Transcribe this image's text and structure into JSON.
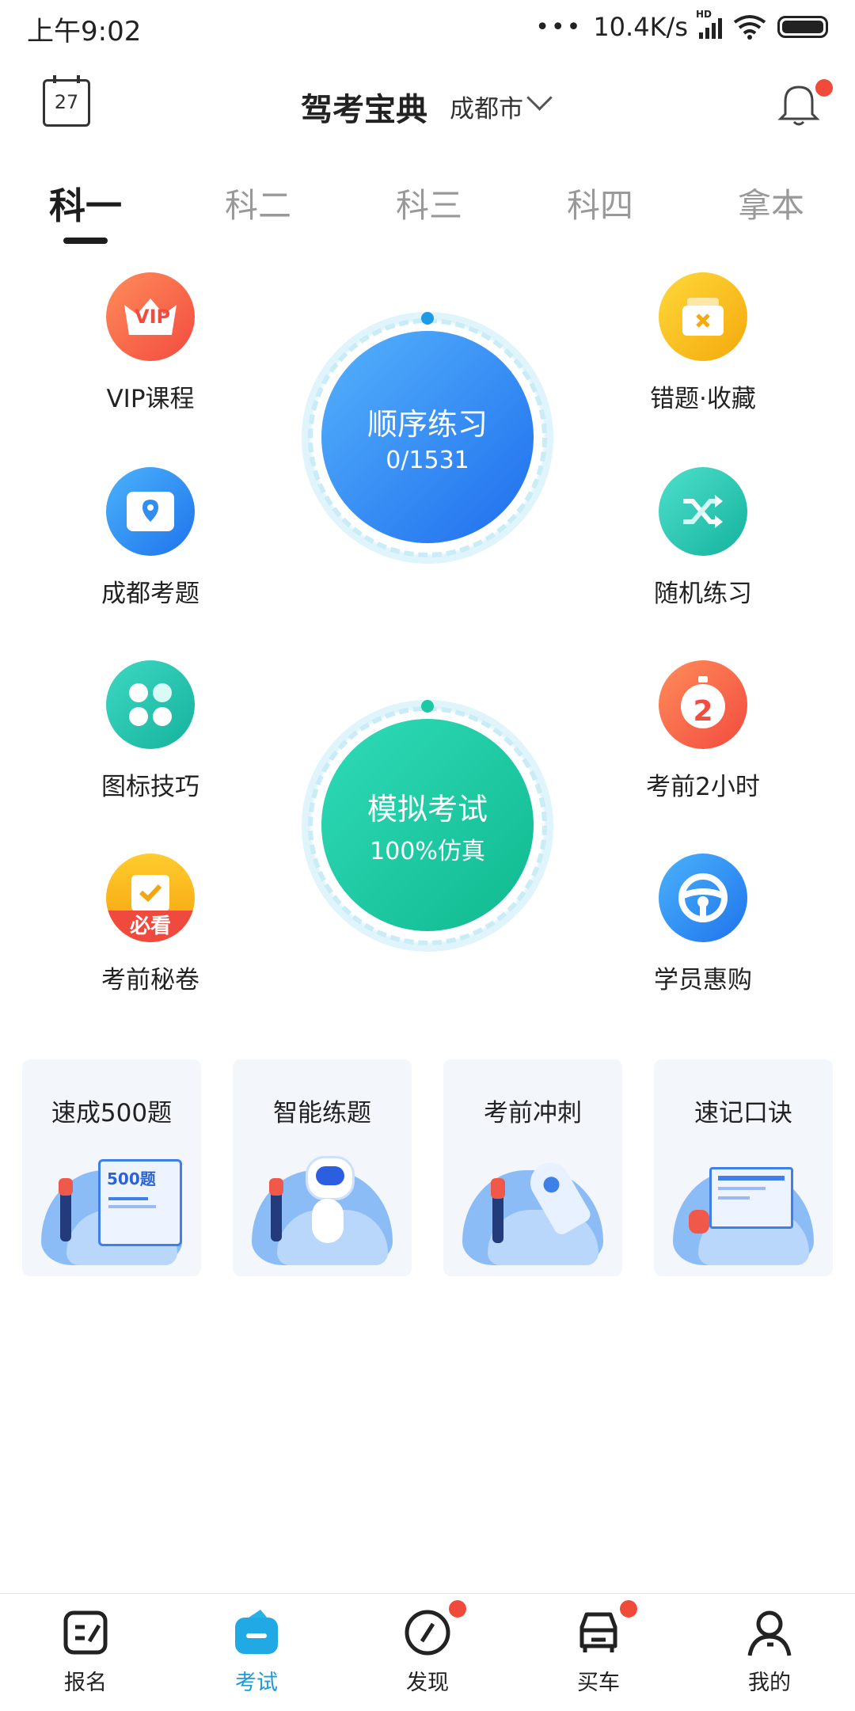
{
  "status": {
    "time": "上午9:02",
    "network_speed": "10.4K/s",
    "signal_label": "HD"
  },
  "header": {
    "calendar_day": "27",
    "title": "驾考宝典",
    "city": "成都市"
  },
  "tabs": [
    {
      "label": "科一",
      "active": true
    },
    {
      "label": "科二",
      "active": false
    },
    {
      "label": "科三",
      "active": false
    },
    {
      "label": "科四",
      "active": false
    },
    {
      "label": "拿本",
      "active": false
    }
  ],
  "left_features": [
    {
      "label": "VIP课程",
      "icon": "vip-crown-icon",
      "badge": "VIP",
      "color": "#f76b4a"
    },
    {
      "label": "成都考题",
      "icon": "map-pin-icon",
      "color": "#2f8ef0"
    },
    {
      "label": "图标技巧",
      "icon": "grid-dots-icon",
      "color": "#23c4b0"
    },
    {
      "label": "考前秘卷",
      "icon": "clipboard-check-icon",
      "badge": "必看",
      "color": "#f7b41b"
    }
  ],
  "right_features": [
    {
      "label": "错题·收藏",
      "icon": "wrong-box-icon",
      "color": "#f6b512"
    },
    {
      "label": "随机练习",
      "icon": "shuffle-icon",
      "color": "#24c7b4"
    },
    {
      "label": "考前2小时",
      "icon": "stopwatch-icon",
      "badge": "2",
      "color": "#f76b4a"
    },
    {
      "label": "学员惠购",
      "icon": "steering-wheel-icon",
      "color": "#2f8ef0"
    }
  ],
  "practice": {
    "title": "顺序练习",
    "progress": "0/1531",
    "done": 0,
    "total": 1531
  },
  "exam": {
    "title": "模拟考试",
    "subtitle": "100%仿真"
  },
  "cards": [
    {
      "label": "速成500题",
      "art_text": "500题"
    },
    {
      "label": "智能练题"
    },
    {
      "label": "考前冲刺"
    },
    {
      "label": "速记口诀"
    }
  ],
  "bottom_nav": [
    {
      "label": "报名",
      "icon": "signup-icon",
      "active": false,
      "dot": false
    },
    {
      "label": "考试",
      "icon": "exam-bag-icon",
      "active": true,
      "dot": false
    },
    {
      "label": "发现",
      "icon": "compass-icon",
      "active": false,
      "dot": true
    },
    {
      "label": "买车",
      "icon": "car-icon",
      "active": false,
      "dot": true
    },
    {
      "label": "我的",
      "icon": "person-icon",
      "active": false,
      "dot": false
    }
  ],
  "colors": {
    "accent": "#1d9bd8",
    "practice_blue": "#2f86f2",
    "exam_green": "#1cc9a3",
    "notify_red": "#f04b3a"
  }
}
